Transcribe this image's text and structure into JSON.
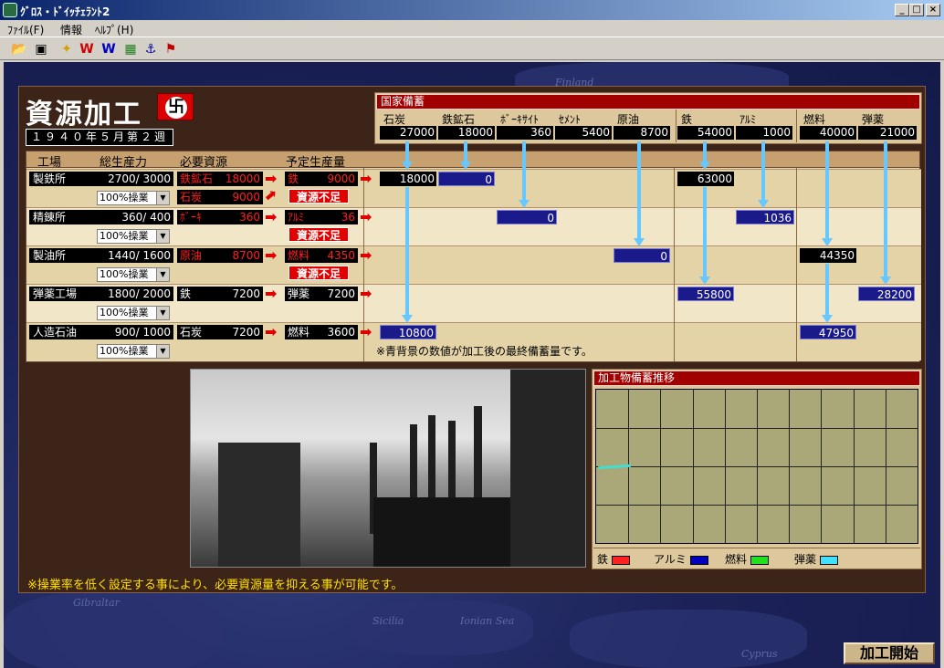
{
  "window": {
    "title": "ｸﾞﾛｽ・ﾄﾞｲｯﾁｪﾗﾝﾄ2",
    "min": "_",
    "max": "□",
    "close": "×"
  },
  "menu": [
    "ﾌｧｲﾙ(F)",
    "情報",
    "ﾍﾙﾌﾟ(H)"
  ],
  "toolbar_icons": [
    "open-folder-icon",
    "save-disk-icon",
    "unit-icon",
    "w-red-icon",
    "w-blue-icon",
    "map-icon",
    "anchor-icon",
    "flag-icon"
  ],
  "map_labels": [
    "Finland",
    "Gibraltar",
    "Sicilia",
    "Ionian Sea",
    "Cyprus"
  ],
  "screen": {
    "title": "資源加工",
    "emblem": "卐",
    "date": "１９４０年５月第２週",
    "hint": "※操業率を低く設定する事により、必要資源量を抑える事が可能です。",
    "start_button": "加工開始"
  },
  "reserve": {
    "title": "国家備蓄",
    "items": [
      {
        "label": "石炭",
        "value": "27000"
      },
      {
        "label": "鉄鉱石",
        "value": "18000"
      },
      {
        "label": "ﾎﾞｰｷｻｲﾄ",
        "value": "360"
      },
      {
        "label": "ｾﾒﾝﾄ",
        "value": "5400"
      },
      {
        "label": "原油",
        "value": "8700"
      },
      {
        "label": "鉄",
        "value": "54000"
      },
      {
        "label": "ｱﾙﾐ",
        "value": "1000"
      },
      {
        "label": "燃料",
        "value": "40000"
      },
      {
        "label": "弾薬",
        "value": "21000"
      }
    ]
  },
  "table": {
    "headers": [
      "工場",
      "総生産力",
      "必要資源",
      "予定生産量"
    ],
    "rows": [
      {
        "name": "製鉄所",
        "capacity": "2700/ 3000",
        "op": "100%操業",
        "req": [
          {
            "name": "鉄鉱石",
            "amt": "18000",
            "red": true
          },
          {
            "name": "石炭",
            "amt": "9000",
            "red": true
          }
        ],
        "out": {
          "name": "鉄",
          "amt": "9000",
          "red": true
        },
        "short": "資源不足"
      },
      {
        "name": "精錬所",
        "capacity": "360/  400",
        "op": "100%操業",
        "req": [
          {
            "name": "ﾎﾞｰｷ",
            "amt": "360",
            "red": true
          }
        ],
        "out": {
          "name": "ｱﾙﾐ",
          "amt": "36",
          "red": true
        },
        "short": "資源不足"
      },
      {
        "name": "製油所",
        "capacity": "1440/ 1600",
        "op": "100%操業",
        "req": [
          {
            "name": "原油",
            "amt": "8700",
            "red": true
          }
        ],
        "out": {
          "name": "燃料",
          "amt": "4350",
          "red": true
        },
        "short": "資源不足"
      },
      {
        "name": "弾薬工場",
        "capacity": "1800/ 2000",
        "op": "100%操業",
        "req": [
          {
            "name": "鉄",
            "amt": "7200",
            "red": false
          }
        ],
        "out": {
          "name": "弾薬",
          "amt": "7200",
          "red": false
        },
        "short": ""
      },
      {
        "name": "人造石油",
        "capacity": "900/ 1000",
        "op": "100%操業",
        "req": [
          {
            "name": "石炭",
            "amt": "7200",
            "red": false
          }
        ],
        "out": {
          "name": "燃料",
          "amt": "3600",
          "red": false
        },
        "short": ""
      }
    ],
    "results": {
      "r0_coal": "18000",
      "r0_ore": "0",
      "r0_iron": "63000",
      "r1_baux": "0",
      "r1_alu": "1036",
      "r2_oil": "0",
      "r2_fuel": "44350",
      "r3_iron": "55800",
      "r3_ammo": "28200",
      "r4_coal": "10800",
      "r4_fuel": "47950"
    },
    "note": "※青背景の数値が加工後の最終備蓄量です。"
  },
  "graph": {
    "title": "加工物備蓄推移",
    "legend": [
      {
        "label": "鉄",
        "color": "#ff2020"
      },
      {
        "label": "アルミ",
        "color": "#0000c0"
      },
      {
        "label": "燃料",
        "color": "#20e020"
      },
      {
        "label": "弾薬",
        "color": "#40e0ff"
      }
    ]
  }
}
